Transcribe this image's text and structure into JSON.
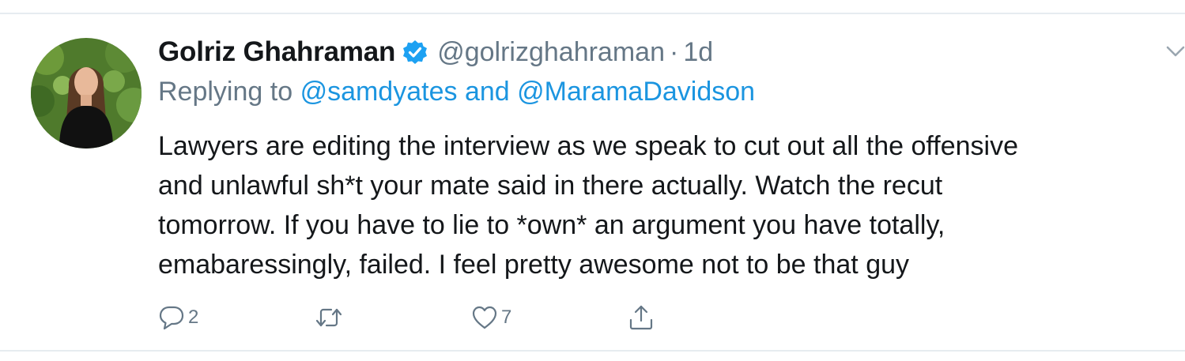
{
  "tweet": {
    "author": {
      "display_name": "Golriz Ghahraman",
      "handle": "@golrizghahraman",
      "verified": true,
      "avatar": "profile-photo"
    },
    "separator": "·",
    "time": "1d",
    "reply_prefix": "Replying to",
    "reply_to_1": "@samdyates",
    "reply_conjunction": "and",
    "reply_to_2": "@MaramaDavidson",
    "text_lines": [
      "Lawyers are editing the interview as we speak to cut out all the offensive",
      "and unlawful sh*t your mate said in there actually. Watch the recut",
      "tomorrow. If you have to lie to *own* an argument you have totally,",
      "emabaressingly, failed. I feel pretty awesome not to be that guy"
    ],
    "actions": {
      "reply_count": "2",
      "retweet_count": "",
      "like_count": "7"
    }
  },
  "icons": {
    "verified": "verified-badge-icon",
    "more": "chevron-down-icon",
    "reply": "comment-bubble-icon",
    "retweet": "retweet-arrows-icon",
    "like": "heart-icon",
    "share": "share-upload-icon"
  },
  "colors": {
    "text": "#14171a",
    "secondary": "#657786",
    "link": "#1b95e0",
    "verified": "#1da1f2",
    "divider": "#e6ecf0"
  }
}
